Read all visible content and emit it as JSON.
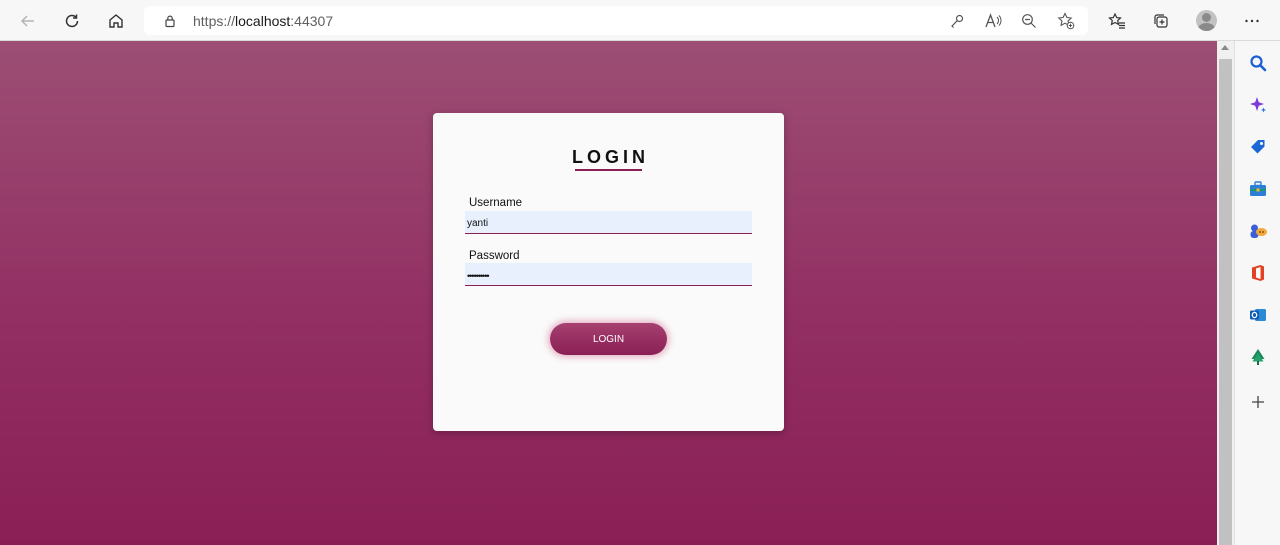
{
  "browser": {
    "url_scheme": "https://",
    "url_host": "localhost",
    "url_port": ":44307",
    "icons": [
      "back-icon",
      "refresh-icon",
      "home-icon",
      "lock-icon",
      "key-icon",
      "read-aloud-icon",
      "zoom-out-icon",
      "add-favorite-icon",
      "favorites-icon",
      "collections-icon",
      "profile-avatar",
      "more-icon"
    ]
  },
  "sidebar": {
    "icons": [
      "search-icon",
      "copilot-icon",
      "shopping-icon",
      "tools-icon",
      "games-icon",
      "office-icon",
      "outlook-icon",
      "tree-icon",
      "add-icon"
    ]
  },
  "login": {
    "title": "LOGIN",
    "username_label": "Username",
    "username_value": "yanti",
    "password_label": "Password",
    "password_value": "yantiyanti",
    "button_label": "LOGIN"
  },
  "colors": {
    "accent": "#8a1f55",
    "background_top": "#9c4e74",
    "background_bottom": "#8a1f55",
    "input_fill": "#e8f0fe"
  }
}
